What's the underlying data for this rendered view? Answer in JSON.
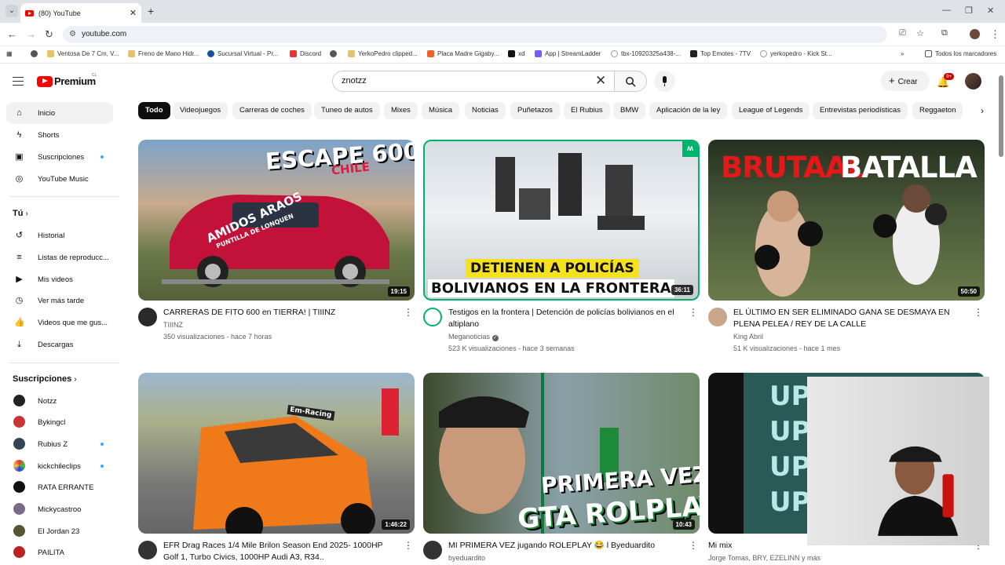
{
  "browser": {
    "tab_title": "(80) YouTube",
    "url": "youtube.com",
    "all_bookmarks": "Todos los marcadores",
    "bookmarks": [
      "Ventosa De 7 Cm, V...",
      "Freno de Mano Hidr...",
      "Sucursal Virtual - Pr...",
      "Discord",
      "YerkoPedro clipped...",
      "Placa Madre Gigaby...",
      "xd",
      "App | StreamLadder",
      "tbx-10920325a438-...",
      "Top Emotes - 7TV",
      "yerkopedro - Kick St..."
    ]
  },
  "header": {
    "logo_text": "Premium",
    "logo_country": "CL",
    "search_value": "znotzz",
    "create_label": "Crear",
    "notif_badge": "9+"
  },
  "sidebar": {
    "main": [
      "Inicio",
      "Shorts",
      "Suscripciones",
      "YouTube Music"
    ],
    "you_title": "Tú",
    "you": [
      "Historial",
      "Listas de reproducc...",
      "Mis videos",
      "Ver más tarde",
      "Videos que me gus...",
      "Descargas"
    ],
    "subs_title": "Suscripciones",
    "subs": [
      "Notzz",
      "Bykingcl",
      "Rubius Z",
      "kickchileclips",
      "RATA ERRANTE",
      "Mickycastroo",
      "El Jordan 23",
      "PAILITA"
    ]
  },
  "chips": [
    "Todo",
    "Videojuegos",
    "Carreras de coches",
    "Tuneo de autos",
    "Mixes",
    "Música",
    "Noticias",
    "Puñetazos",
    "El Rubius",
    "BMW",
    "Aplicación de la ley",
    "League of Legends",
    "Entrevistas periodísticas",
    "Reggaeton"
  ],
  "videos": [
    {
      "title": "CARRERAS DE FITO 600 en TIERRA! | TIIINZ",
      "channel": "TIIINZ",
      "meta": "350 visualizaciones - hace 7 horas",
      "duration": "19:15",
      "thumb_text": [
        "ESCAPE 600",
        "CHILE",
        "AMIDOS ARAOS",
        "PUNTILLA DE LONQUEN"
      ]
    },
    {
      "title": "Testigos en la frontera | Detención de policías bolivianos en el altiplano",
      "channel": "Meganoticias",
      "meta": "523 K visualizaciones - hace 3 semanas",
      "duration": "36:11",
      "thumb_text": [
        "DETIENEN A POLICÍAS",
        "BOLIVIANOS EN LA FRONTERA"
      ]
    },
    {
      "title": "EL ÚLTIMO EN SER ELIMINADO GANA SE DESMAYA EN PLENA PELEA / REY DE LA CALLE",
      "channel": "King Abril",
      "meta": "51 K visualizaciones - hace 1 mes",
      "duration": "50:50",
      "thumb_text": [
        "BRUTAAL",
        "BATALLA"
      ]
    },
    {
      "title": "EFR Drag Races 1/4 Mile Brilon Season End 2025- 1000HP Golf 1, Turbo Civics, 1000HP Audi A3, R34..",
      "channel": "",
      "meta": "",
      "duration": "1:46:22",
      "thumb_text": [
        "Em-Racing"
      ]
    },
    {
      "title": "MI PRIMERA VEZ jugando ROLEPLAY 😂 l Byeduardito",
      "channel": "byeduardito",
      "meta": "",
      "duration": "10:43",
      "thumb_text": [
        "PRIMERA VEZ",
        "GTA ROLPLAY"
      ]
    },
    {
      "title": "Mi mix",
      "channel": "Jorge Tomas, BRY, EZELINN y más",
      "meta": "",
      "duration": "",
      "thumb_text": [
        "UP"
      ]
    }
  ],
  "colors": {
    "brand": "#ff0000",
    "accent": "#3ea6ff",
    "meganoticias": "#00b36b"
  }
}
